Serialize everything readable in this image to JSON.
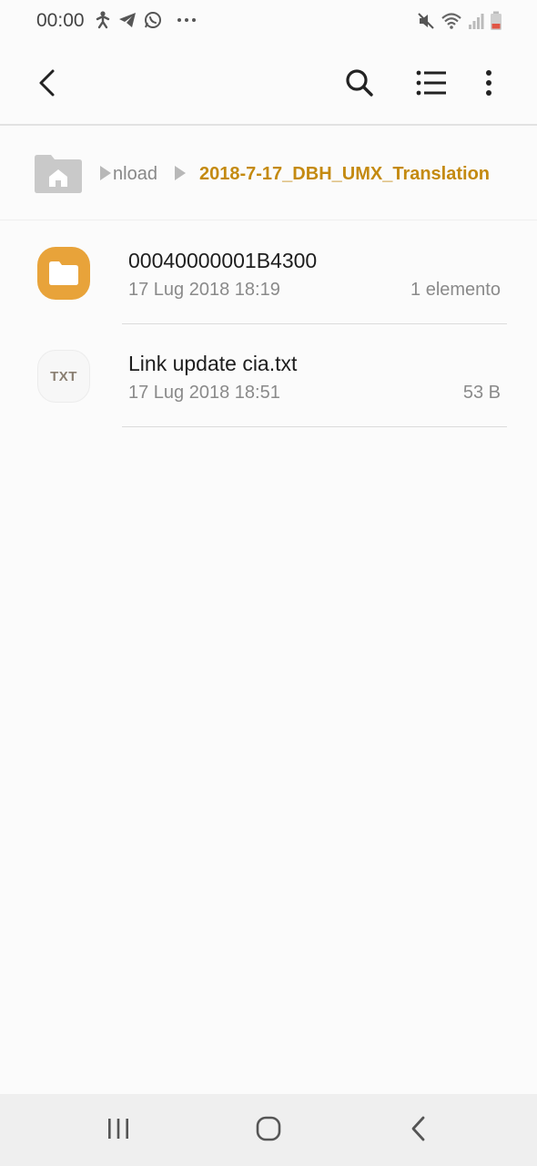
{
  "status_bar": {
    "time": "00:00",
    "left_icons": [
      "accessibility-icon",
      "telegram-icon",
      "whatsapp-icon",
      "more-notifications-icon"
    ],
    "right_icons": [
      "mute-icon",
      "wifi-icon",
      "signal-icon",
      "battery-icon"
    ],
    "battery_color": "#e05545"
  },
  "app_bar": {
    "back": "back-icon",
    "actions": [
      "search-icon",
      "list-view-icon",
      "more-options-icon"
    ]
  },
  "breadcrumb": {
    "home": "home-icon",
    "previous": "nload",
    "current": "2018-7-17_DBH_UMX_Translation",
    "accent_color": "#c48a10"
  },
  "files": [
    {
      "type": "folder",
      "name": "00040000001B4300",
      "date": "17 Lug 2018 18:19",
      "meta": "1 elemento",
      "icon_color": "#e8a33a"
    },
    {
      "type": "txt",
      "badge": "TXT",
      "name": "Link update cia.txt",
      "date": "17 Lug 2018 18:51",
      "meta": "53 B"
    }
  ],
  "nav_bar": {
    "buttons": [
      "recent-apps-icon",
      "home-button-icon",
      "back-nav-icon"
    ]
  }
}
